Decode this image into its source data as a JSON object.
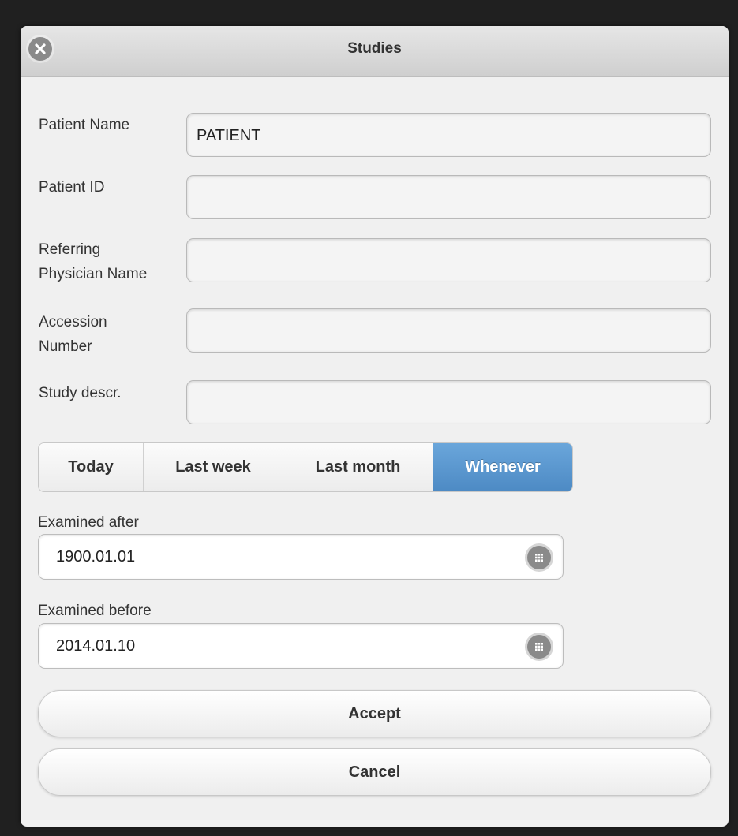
{
  "dialog": {
    "title": "Studies",
    "close_icon": "close-icon"
  },
  "form": {
    "fields": [
      {
        "label": "Patient Name",
        "value": "PATIENT"
      },
      {
        "label": "Patient ID",
        "value": ""
      },
      {
        "label_line1": "Referring",
        "label_line2": "Physician Name",
        "value": ""
      },
      {
        "label_line1": "Accession",
        "label_line2": "Number",
        "value": ""
      },
      {
        "label": "Study descr.",
        "value": ""
      }
    ]
  },
  "period": {
    "options": [
      "Today",
      "Last week",
      "Last month",
      "Whenever"
    ],
    "selected": "Whenever",
    "active_color": "#5b97d0"
  },
  "dates": {
    "after_label": "Examined after",
    "after_value": "1900.01.01",
    "before_label": "Examined before",
    "before_value": "2014.01.10",
    "picker_icon": "calendar-grid-icon"
  },
  "buttons": {
    "accept": "Accept",
    "cancel": "Cancel"
  }
}
